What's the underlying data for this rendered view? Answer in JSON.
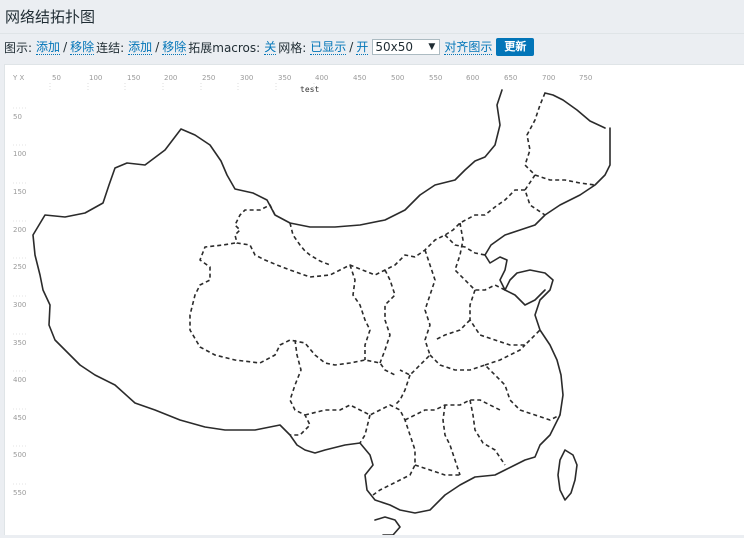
{
  "page": {
    "title": "网络结拓扑图"
  },
  "toolbar": {
    "icon_label": "图示:",
    "icon_add": "添加",
    "icon_remove": "移除",
    "link_label": "连结:",
    "link_add": "添加",
    "link_remove": "移除",
    "macros_label": "拓展macros:",
    "macros_value": "关",
    "grid_label": "网格:",
    "grid_shown": "已显示",
    "grid_on": "开",
    "slash": "/",
    "grid_size": "50x50",
    "align_label": "对齐图示",
    "update_label": "更新"
  },
  "map": {
    "title": "test",
    "corner_label": "Y X",
    "x_ticks": [
      "50",
      "100",
      "150",
      "200",
      "250",
      "300",
      "350",
      "400",
      "450",
      "500",
      "550",
      "600",
      "650",
      "700",
      "750"
    ],
    "y_ticks": [
      "50",
      "100",
      "150",
      "200",
      "250",
      "300",
      "350",
      "400",
      "450",
      "500",
      "550"
    ],
    "region": "china-outline"
  }
}
